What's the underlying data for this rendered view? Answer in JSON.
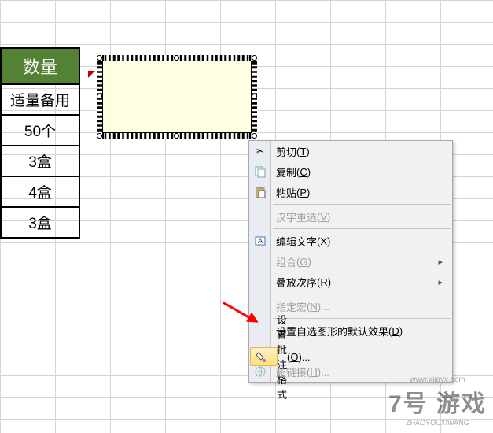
{
  "table": {
    "header": "数量",
    "rows": [
      "适量备用",
      "50个",
      "3盒",
      "4盒",
      "3盒"
    ]
  },
  "menu": {
    "cut": "剪切",
    "cut_k": "T",
    "copy": "复制",
    "copy_k": "C",
    "paste": "粘贴",
    "paste_k": "P",
    "reconv": "汉字重选",
    "reconv_k": "V",
    "edit_text": "编辑文字",
    "edit_text_k": "X",
    "group": "组合",
    "group_k": "G",
    "order": "叠放次序",
    "order_k": "R",
    "assign_macro": "指定宏",
    "assign_macro_k": "N",
    "default_shape": "设置自选图形的默认效果",
    "default_shape_k": "D",
    "format_comment": "设置批注格式",
    "format_comment_k": "O",
    "hyperlink": "超链接",
    "hyperlink_k": "H"
  },
  "watermark": {
    "big": "7号 游戏",
    "sub": "www.xiiayx.com",
    "py": "ZHAOYOUXIWANG"
  }
}
